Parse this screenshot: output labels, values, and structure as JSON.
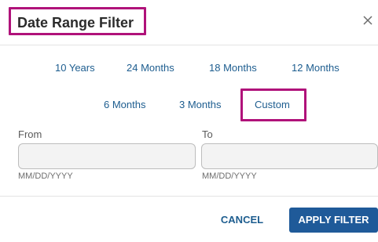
{
  "dialog": {
    "title": "Date Range Filter",
    "close_icon": "close-icon"
  },
  "ranges": {
    "row1": [
      "10 Years",
      "24 Months",
      "18 Months",
      "12 Months"
    ],
    "row2": [
      "6 Months",
      "3 Months",
      "Custom"
    ],
    "selected": "Custom"
  },
  "from": {
    "label": "From",
    "value": "",
    "hint": "MM/DD/YYYY"
  },
  "to": {
    "label": "To",
    "value": "",
    "hint": "MM/DD/YYYY"
  },
  "footer": {
    "cancel_label": "CANCEL",
    "apply_label": "APPLY FILTER"
  },
  "colors": {
    "accent": "#1f5a99",
    "link": "#1d5d8f",
    "highlight": "#b0127a"
  }
}
